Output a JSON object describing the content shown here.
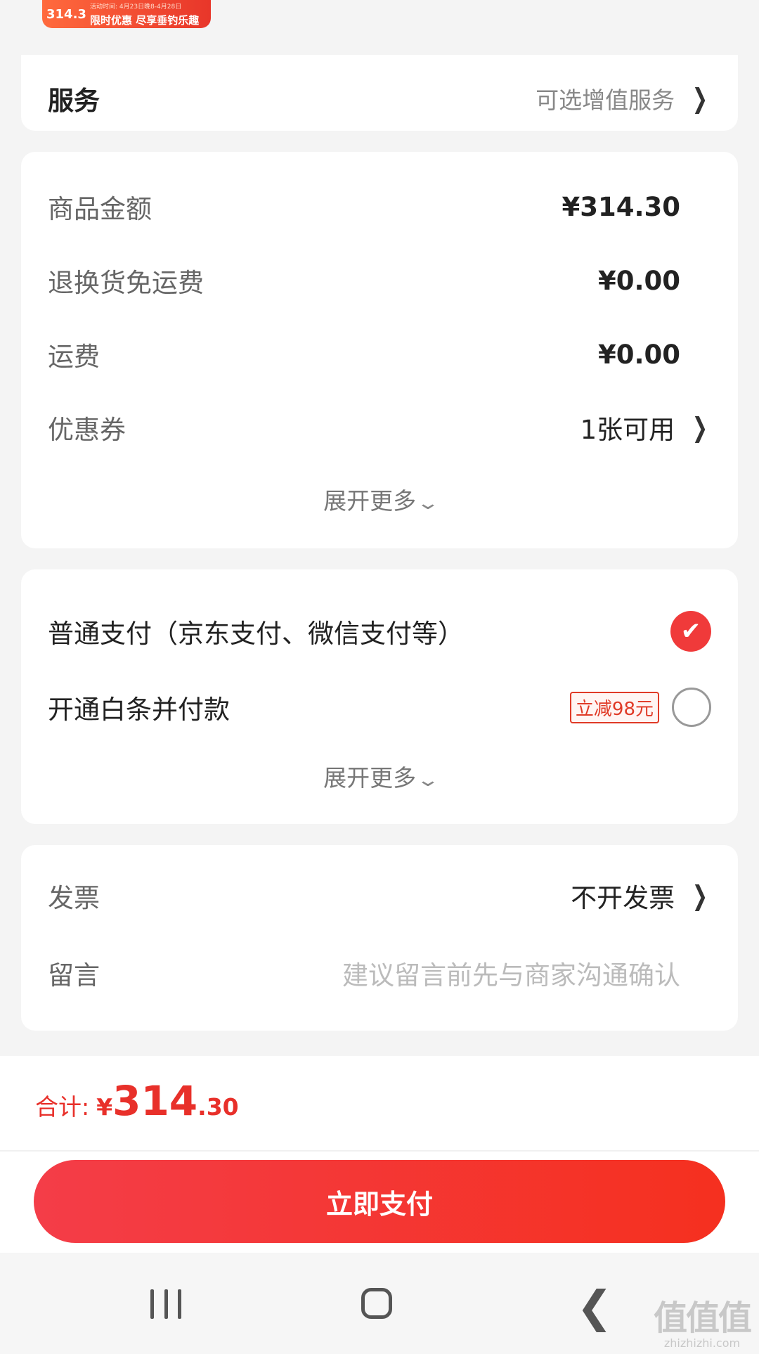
{
  "thumbnail": {
    "price": "314.3",
    "promo": "限时优惠 尽享垂钓乐趣",
    "tiny_text": "活动时间: 4月23日晚8-4月28日"
  },
  "service": {
    "title": "服务",
    "value": "可选增值服务"
  },
  "summary": {
    "rows": [
      {
        "label": "商品金额",
        "value": "¥314.30"
      },
      {
        "label": "退换货免运费",
        "value": "¥0.00"
      },
      {
        "label": "运费",
        "value": "¥0.00"
      },
      {
        "label": "优惠券",
        "value": "1张可用"
      }
    ],
    "expand": "展开更多"
  },
  "payment": {
    "options": [
      {
        "label": "普通支付（京东支付、微信支付等）",
        "selected": true
      },
      {
        "label": "开通白条并付款",
        "badge": "立减98元",
        "selected": false
      }
    ],
    "expand": "展开更多"
  },
  "extra": {
    "invoice_label": "发票",
    "invoice_value": "不开发票",
    "message_label": "留言",
    "message_placeholder": "建议留言前先与商家沟通确认"
  },
  "footer": {
    "total_label": "合计:",
    "currency": "¥",
    "amount_int": "314",
    "amount_dec": ".30",
    "pay_button": "立即支付"
  },
  "watermark": {
    "big": "值值值",
    "small": "zhizhizhi.com"
  },
  "colors": {
    "accent": "#e8302a",
    "background": "#f4f4f4"
  }
}
